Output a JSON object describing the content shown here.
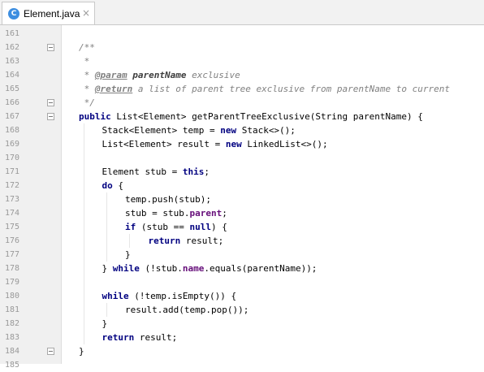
{
  "editor_tab": {
    "icon_letter": "C",
    "icon_color": "#3d8ee0",
    "filename": "Element.java",
    "close_glyph": "×"
  },
  "colors": {
    "keyword": "#000080",
    "comment": "#808080",
    "field": "#660e7a",
    "line_number": "#999999",
    "gutter_background": "#f0f0f0"
  },
  "fold_markers_on_lines": [
    162,
    166,
    167,
    184
  ],
  "code_lines": [
    {
      "num": "161",
      "indent": 0,
      "tokens": []
    },
    {
      "num": "162",
      "indent": 0,
      "tokens": [
        {
          "t": "/**",
          "k": "c"
        }
      ]
    },
    {
      "num": "163",
      "indent": 0,
      "tokens": [
        {
          "t": " *",
          "k": "c"
        }
      ]
    },
    {
      "num": "164",
      "indent": 0,
      "tokens": [
        {
          "t": " * ",
          "k": "c"
        },
        {
          "t": "@param",
          "k": "d"
        },
        {
          "t": " ",
          "k": "c"
        },
        {
          "t": "parentName",
          "k": "dv"
        },
        {
          "t": " exclusive",
          "k": "c"
        }
      ]
    },
    {
      "num": "165",
      "indent": 0,
      "tokens": [
        {
          "t": " * ",
          "k": "c"
        },
        {
          "t": "@return",
          "k": "d"
        },
        {
          "t": " a list of parent tree exclusive from parentName to current",
          "k": "c"
        }
      ]
    },
    {
      "num": "166",
      "indent": 0,
      "tokens": [
        {
          "t": " */",
          "k": "c"
        }
      ]
    },
    {
      "num": "167",
      "indent": 0,
      "tokens": [
        {
          "t": "public",
          "k": "k"
        },
        {
          "t": " List<Element> getParentTreeExclusive(String parentName) {",
          "k": "t"
        }
      ]
    },
    {
      "num": "168",
      "indent": 1,
      "tokens": [
        {
          "t": "Stack<Element> temp = ",
          "k": "t"
        },
        {
          "t": "new",
          "k": "k"
        },
        {
          "t": " Stack<>();",
          "k": "t"
        }
      ]
    },
    {
      "num": "169",
      "indent": 1,
      "tokens": [
        {
          "t": "List<Element> result = ",
          "k": "t"
        },
        {
          "t": "new",
          "k": "k"
        },
        {
          "t": " LinkedList<>();",
          "k": "t"
        }
      ]
    },
    {
      "num": "170",
      "indent": 0,
      "tokens": []
    },
    {
      "num": "171",
      "indent": 1,
      "tokens": [
        {
          "t": "Element stub = ",
          "k": "t"
        },
        {
          "t": "this",
          "k": "k"
        },
        {
          "t": ";",
          "k": "t"
        }
      ]
    },
    {
      "num": "172",
      "indent": 1,
      "tokens": [
        {
          "t": "do",
          "k": "k"
        },
        {
          "t": " {",
          "k": "t"
        }
      ]
    },
    {
      "num": "173",
      "indent": 2,
      "tokens": [
        {
          "t": "temp.push(stub);",
          "k": "t"
        }
      ]
    },
    {
      "num": "174",
      "indent": 2,
      "tokens": [
        {
          "t": "stub = stub.",
          "k": "t"
        },
        {
          "t": "parent",
          "k": "f"
        },
        {
          "t": ";",
          "k": "t"
        }
      ]
    },
    {
      "num": "175",
      "indent": 2,
      "tokens": [
        {
          "t": "if",
          "k": "k"
        },
        {
          "t": " (stub == ",
          "k": "t"
        },
        {
          "t": "null",
          "k": "k"
        },
        {
          "t": ") {",
          "k": "t"
        }
      ]
    },
    {
      "num": "176",
      "indent": 3,
      "tokens": [
        {
          "t": "return",
          "k": "k"
        },
        {
          "t": " result;",
          "k": "t"
        }
      ]
    },
    {
      "num": "177",
      "indent": 2,
      "tokens": [
        {
          "t": "}",
          "k": "t"
        }
      ]
    },
    {
      "num": "178",
      "indent": 1,
      "tokens": [
        {
          "t": "} ",
          "k": "t"
        },
        {
          "t": "while",
          "k": "k"
        },
        {
          "t": " (!stub.",
          "k": "t"
        },
        {
          "t": "name",
          "k": "f"
        },
        {
          "t": ".equals(parentName));",
          "k": "t"
        }
      ]
    },
    {
      "num": "179",
      "indent": 0,
      "tokens": []
    },
    {
      "num": "180",
      "indent": 1,
      "tokens": [
        {
          "t": "while",
          "k": "k"
        },
        {
          "t": " (!temp.isEmpty()) {",
          "k": "t"
        }
      ]
    },
    {
      "num": "181",
      "indent": 2,
      "tokens": [
        {
          "t": "result.add(temp.pop());",
          "k": "t"
        }
      ]
    },
    {
      "num": "182",
      "indent": 1,
      "tokens": [
        {
          "t": "}",
          "k": "t"
        }
      ]
    },
    {
      "num": "183",
      "indent": 1,
      "tokens": [
        {
          "t": "return",
          "k": "k"
        },
        {
          "t": " result;",
          "k": "t"
        }
      ]
    },
    {
      "num": "184",
      "indent": 0,
      "tokens": [
        {
          "t": "}",
          "k": "t"
        }
      ]
    },
    {
      "num": "185",
      "indent": 0,
      "tokens": []
    }
  ]
}
